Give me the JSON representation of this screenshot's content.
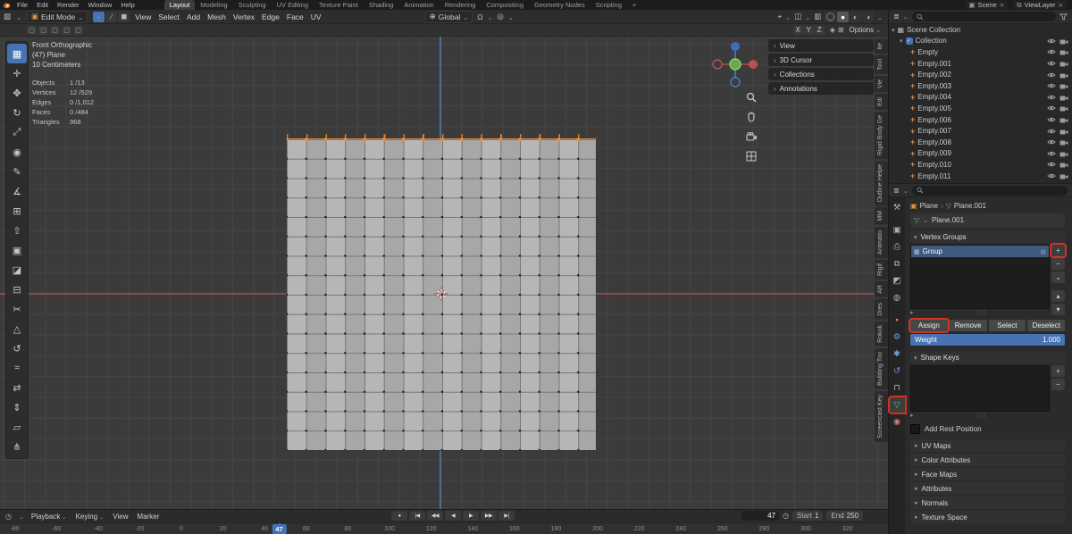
{
  "topbar": {
    "menus": [
      "File",
      "Edit",
      "Render",
      "Window",
      "Help"
    ],
    "workspaces": [
      {
        "label": "Layout",
        "active": true
      },
      {
        "label": "Modeling"
      },
      {
        "label": "Sculpting"
      },
      {
        "label": "UV Editing"
      },
      {
        "label": "Texture Paint"
      },
      {
        "label": "Shading"
      },
      {
        "label": "Animation"
      },
      {
        "label": "Rendering"
      },
      {
        "label": "Compositing"
      },
      {
        "label": "Geometry Nodes"
      },
      {
        "label": "Scripting"
      },
      {
        "label": "+"
      }
    ],
    "scene_label": "Scene",
    "viewlayer_label": "ViewLayer"
  },
  "viewport_header": {
    "mode_label": "Edit Mode",
    "select_modes": [
      {
        "glyph": "∙",
        "name": "vertex-select",
        "active": true
      },
      {
        "glyph": "∕",
        "name": "edge-select"
      },
      {
        "glyph": "◼",
        "name": "face-select"
      }
    ],
    "menus": [
      "View",
      "Select",
      "Add",
      "Mesh",
      "Vertex",
      "Edge",
      "Face",
      "UV"
    ],
    "orientation_label": "Global",
    "snap_icon": "Ω",
    "proportional_icon": "◎",
    "gizmo_icon": "⌖",
    "overlays_icon": "◫",
    "xray_icon": "▥",
    "shading_modes": [
      {
        "glyph": "◯",
        "name": "wireframe"
      },
      {
        "glyph": "●",
        "name": "solid",
        "active": true
      },
      {
        "glyph": "◐",
        "name": "material-preview"
      },
      {
        "glyph": "◑",
        "name": "rendered"
      }
    ]
  },
  "tool_settings": {
    "left_icons": [
      {
        "glyph": "▢",
        "name": "collection-toggle-1"
      },
      {
        "glyph": "▢",
        "name": "collection-toggle-2"
      },
      {
        "glyph": "▢",
        "name": "collection-toggle-3"
      },
      {
        "glyph": "▢",
        "name": "collection-toggle-4"
      },
      {
        "glyph": "▢",
        "name": "collection-toggle-5"
      }
    ],
    "mirror_axes": [
      "X",
      "Y",
      "Z"
    ],
    "extra_icons": [
      {
        "glyph": "◈",
        "name": "snap-toggle"
      },
      {
        "glyph": "⊞",
        "name": "overlap-toggle"
      }
    ],
    "options_label": "Options"
  },
  "tools": [
    {
      "glyph": "▦",
      "name": "select-box",
      "active": true
    },
    {
      "glyph": "✛",
      "name": "cursor"
    },
    {
      "glyph": "✥",
      "name": "move"
    },
    {
      "glyph": "↻",
      "name": "rotate"
    },
    {
      "glyph": "⤢",
      "name": "scale"
    },
    {
      "glyph": "◉",
      "name": "transform"
    },
    {
      "glyph": "✎",
      "name": "annotate"
    },
    {
      "glyph": "∡",
      "name": "measure"
    },
    {
      "glyph": "⊞",
      "name": "add-cube"
    },
    {
      "glyph": "⇧",
      "name": "extrude-region"
    },
    {
      "glyph": "▣",
      "name": "inset-faces"
    },
    {
      "glyph": "◪",
      "name": "bevel"
    },
    {
      "glyph": "⊟",
      "name": "loop-cut"
    },
    {
      "glyph": "✂",
      "name": "knife"
    },
    {
      "glyph": "△",
      "name": "poly-build"
    },
    {
      "glyph": "↺",
      "name": "spin"
    },
    {
      "glyph": "≈",
      "name": "smooth"
    },
    {
      "glyph": "⇄",
      "name": "edge-slide"
    },
    {
      "glyph": "⇕",
      "name": "shrink-fatten"
    },
    {
      "glyph": "▱",
      "name": "shear"
    },
    {
      "glyph": "⋔",
      "name": "rip-region"
    }
  ],
  "viewport": {
    "view_label": "Front Orthographic",
    "object_label": "(47) Plane",
    "unit_label": "10 Centimeters",
    "stats": [
      {
        "label": "Objects",
        "value": "1 /13"
      },
      {
        "label": "Vertices",
        "value": "12 /529"
      },
      {
        "label": "Edges",
        "value": "0 /1,012"
      },
      {
        "label": "Faces",
        "value": "0 /484"
      },
      {
        "label": "Triangles",
        "value": "968"
      }
    ],
    "overlay_panels": [
      "View",
      "3D Cursor",
      "Collections",
      "Annotations"
    ]
  },
  "sidebar_tabs": [
    "Ite",
    "Tool",
    "Vie",
    "Edi",
    "Rigid Body Ge",
    "Outline Helpe",
    "MM",
    "Animatio",
    "Rigif",
    "AR",
    "Dres",
    "Rokok",
    "Building Too",
    "Screencast Key"
  ],
  "outliner": {
    "root_label": "Scene Collection",
    "collection_label": "Collection",
    "empties": [
      "Empty",
      "Empty.001",
      "Empty.002",
      "Empty.003",
      "Empty.004",
      "Empty.005",
      "Empty.006",
      "Empty.007",
      "Empty.008",
      "Empty.009",
      "Empty.010",
      "Empty.011"
    ]
  },
  "properties": {
    "tabs": [
      {
        "glyph": "⚒",
        "name": "tool",
        "color": "#b0b0b0"
      },
      {
        "glyph": "▣",
        "name": "render",
        "color": "#b0b0b0",
        "gap": true
      },
      {
        "glyph": "⎙",
        "name": "output",
        "color": "#b0b0b0"
      },
      {
        "glyph": "⧉",
        "name": "view-layer",
        "color": "#b0b0b0"
      },
      {
        "glyph": "◩",
        "name": "scene",
        "color": "#b0b0b0"
      },
      {
        "glyph": "◍",
        "name": "world",
        "color": "#b0b0b0"
      },
      {
        "glyph": "▪",
        "name": "object",
        "color": "#e0913f",
        "gap": true
      },
      {
        "glyph": "⚙",
        "name": "modifiers",
        "color": "#6f9fd8"
      },
      {
        "glyph": "✱",
        "name": "particles",
        "color": "#6f9fd8"
      },
      {
        "glyph": "↺",
        "name": "physics",
        "color": "#6f9fd8"
      },
      {
        "glyph": "⊓",
        "name": "constraints",
        "color": "#b0b0b0"
      },
      {
        "glyph": "▽",
        "name": "object-data",
        "color": "#5fba7d",
        "active": true,
        "annotated": true
      },
      {
        "glyph": "◉",
        "name": "material",
        "color": "#d97a7a"
      }
    ],
    "breadcrumb": {
      "object_label": "Plane",
      "data_label": "Plane.001"
    },
    "mesh_name": "Plane.001",
    "vertex_groups": {
      "title": "Vertex Groups",
      "group_name": "Group",
      "ops": [
        {
          "glyph": "+",
          "name": "add",
          "annotated": true
        },
        {
          "glyph": "−",
          "name": "remove"
        },
        {
          "glyph": "⌄",
          "name": "specials"
        },
        {
          "glyph": "▴",
          "name": "move-up",
          "gap": true
        },
        {
          "glyph": "▾",
          "name": "move-down"
        }
      ],
      "buttons": [
        {
          "label": "Assign",
          "name": "assign",
          "annotated": true
        },
        {
          "label": "Remove",
          "name": "remove"
        },
        {
          "label": "Select",
          "name": "select"
        },
        {
          "label": "Deselect",
          "name": "deselect"
        }
      ],
      "weight_label": "Weight",
      "weight_value": "1.000"
    },
    "shape_keys": {
      "title": "Shape Keys",
      "ops": [
        {
          "glyph": "+",
          "name": "add"
        },
        {
          "glyph": "−",
          "name": "remove"
        }
      ]
    },
    "add_rest_label": "Add Rest Position",
    "sections": [
      "UV Maps",
      "Color Attributes",
      "Face Maps",
      "Attributes",
      "Normals",
      "Texture Space"
    ]
  },
  "timeline": {
    "menus": [
      {
        "label": "Playback",
        "chev": true
      },
      {
        "label": "Keying",
        "chev": true
      },
      {
        "label": "View"
      },
      {
        "label": "Marker"
      }
    ],
    "transport": [
      {
        "glyph": "●",
        "name": "auto-keying"
      },
      {
        "glyph": "|◀",
        "name": "jump-to-start"
      },
      {
        "glyph": "◀◀",
        "name": "prev-keyframe"
      },
      {
        "glyph": "◀",
        "name": "play-reverse"
      },
      {
        "glyph": "▶",
        "name": "play"
      },
      {
        "glyph": "▶▶",
        "name": "next-keyframe"
      },
      {
        "glyph": "▶|",
        "name": "jump-to-end"
      }
    ],
    "current_frame": "47",
    "start_label": "Start",
    "start_value": "1",
    "end_label": "End",
    "end_value": "250",
    "ticks": [
      -80,
      -60,
      -40,
      -20,
      0,
      20,
      40,
      60,
      80,
      100,
      120,
      140,
      160,
      180,
      200,
      220,
      240,
      260,
      280,
      300,
      320
    ]
  },
  "colors": {
    "accent": "#4772b3",
    "selection_orange": "#e8862d",
    "annotation": "#d6301f"
  }
}
